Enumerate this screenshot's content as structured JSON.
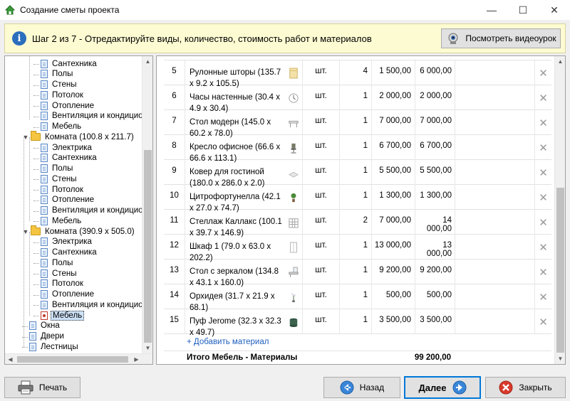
{
  "window": {
    "title": "Создание сметы проекта",
    "minimize": "—",
    "maximize": "☐",
    "close": "✕"
  },
  "infobar": {
    "text": "Шаг 2 из 7 - Отредактируйте виды, количество, стоимость работ и материалов",
    "video_button": "Посмотреть видеоурок"
  },
  "tree": [
    {
      "label": "Сантехника",
      "level": 2,
      "icon": "doc"
    },
    {
      "label": "Полы",
      "level": 2,
      "icon": "doc"
    },
    {
      "label": "Стены",
      "level": 2,
      "icon": "doc"
    },
    {
      "label": "Потолок",
      "level": 2,
      "icon": "doc"
    },
    {
      "label": "Отопление",
      "level": 2,
      "icon": "doc"
    },
    {
      "label": "Вентиляция и кондиционир",
      "level": 2,
      "icon": "doc"
    },
    {
      "label": "Мебель",
      "level": 2,
      "icon": "doc"
    },
    {
      "label": "Комната (100.8 x 211.7)",
      "level": 1,
      "icon": "folder",
      "expanded": true
    },
    {
      "label": "Электрика",
      "level": 2,
      "icon": "doc"
    },
    {
      "label": "Сантехника",
      "level": 2,
      "icon": "doc"
    },
    {
      "label": "Полы",
      "level": 2,
      "icon": "doc"
    },
    {
      "label": "Стены",
      "level": 2,
      "icon": "doc"
    },
    {
      "label": "Потолок",
      "level": 2,
      "icon": "doc"
    },
    {
      "label": "Отопление",
      "level": 2,
      "icon": "doc"
    },
    {
      "label": "Вентиляция и кондиционир",
      "level": 2,
      "icon": "doc"
    },
    {
      "label": "Мебель",
      "level": 2,
      "icon": "doc"
    },
    {
      "label": "Комната (390.9 x 505.0)",
      "level": 1,
      "icon": "folder",
      "expanded": true
    },
    {
      "label": "Электрика",
      "level": 2,
      "icon": "doc"
    },
    {
      "label": "Сантехника",
      "level": 2,
      "icon": "doc"
    },
    {
      "label": "Полы",
      "level": 2,
      "icon": "doc"
    },
    {
      "label": "Стены",
      "level": 2,
      "icon": "doc"
    },
    {
      "label": "Потолок",
      "level": 2,
      "icon": "doc"
    },
    {
      "label": "Отопление",
      "level": 2,
      "icon": "doc"
    },
    {
      "label": "Вентиляция и кондиционир",
      "level": 2,
      "icon": "doc"
    },
    {
      "label": "Мебель",
      "level": 2,
      "icon": "doc-red",
      "selected": true
    },
    {
      "label": "Окна",
      "level": 1,
      "icon": "doc"
    },
    {
      "label": "Двери",
      "level": 1,
      "icon": "doc"
    },
    {
      "label": "Лестницы",
      "level": 1,
      "icon": "doc"
    }
  ],
  "materials": [
    {
      "num": "5",
      "name": "Рулонные шторы (135.7 x 9.2 x 105.5)",
      "icon": "roller-blind-icon",
      "unit": "шт.",
      "qty": "4",
      "price": "1 500,00",
      "total": "6 000,00"
    },
    {
      "num": "6",
      "name": "Часы настенные (30.4 x 4.9 x 30.4)",
      "icon": "wall-clock-icon",
      "unit": "шт.",
      "qty": "1",
      "price": "2 000,00",
      "total": "2 000,00"
    },
    {
      "num": "7",
      "name": "Стол модерн (145.0 x 60.2 x 78.0)",
      "icon": "table-icon",
      "unit": "шт.",
      "qty": "1",
      "price": "7 000,00",
      "total": "7 000,00"
    },
    {
      "num": "8",
      "name": "Кресло офисное (66.6 x 66.6 x 113.1)",
      "icon": "office-chair-icon",
      "unit": "шт.",
      "qty": "1",
      "price": "6 700,00",
      "total": "6 700,00"
    },
    {
      "num": "9",
      "name": "Ковер для гостиной (180.0 x 286.0 x 2.0)",
      "icon": "carpet-icon",
      "unit": "шт.",
      "qty": "1",
      "price": "5 500,00",
      "total": "5 500,00"
    },
    {
      "num": "10",
      "name": "Цитрофортунелла (42.1 x 27.0 x 74.7)",
      "icon": "plant-icon",
      "unit": "шт.",
      "qty": "1",
      "price": "1 300,00",
      "total": "1 300,00"
    },
    {
      "num": "11",
      "name": "Стеллаж Каллакс (100.1 x 39.7 x 146.9)",
      "icon": "shelf-icon",
      "unit": "шт.",
      "qty": "2",
      "price": "7 000,00",
      "total": "14 000,00"
    },
    {
      "num": "12",
      "name": "Шкаф 1 (79.0 x 63.0 x 202.2)",
      "icon": "wardrobe-icon",
      "unit": "шт.",
      "qty": "1",
      "price": "13 000,00",
      "total": "13 000,00"
    },
    {
      "num": "13",
      "name": "Стол с зеркалом (134.8 x 43.1 x 160.0)",
      "icon": "vanity-table-icon",
      "unit": "шт.",
      "qty": "1",
      "price": "9 200,00",
      "total": "9 200,00"
    },
    {
      "num": "14",
      "name": "Орхидея (31.7 x 21.9 x 68.1)",
      "icon": "orchid-icon",
      "unit": "шт.",
      "qty": "1",
      "price": "500,00",
      "total": "500,00"
    },
    {
      "num": "15",
      "name": "Пуф Jerome (32.3 x 32.3 x 49.7)",
      "icon": "pouf-icon",
      "unit": "шт.",
      "qty": "1",
      "price": "3 500,00",
      "total": "3 500,00"
    }
  ],
  "add_material": "+ Добавить материал",
  "total_label": "Итого Мебель - Материалы",
  "total_value": "99 200,00",
  "buttons": {
    "print": "Печать",
    "back": "Назад",
    "next": "Далее",
    "close": "Закрыть"
  },
  "colors": {
    "infobar_bg": "#fdfbd2",
    "link": "#1f5fbf",
    "primary_border": "#0078d7",
    "selection": "#cde1f7"
  }
}
